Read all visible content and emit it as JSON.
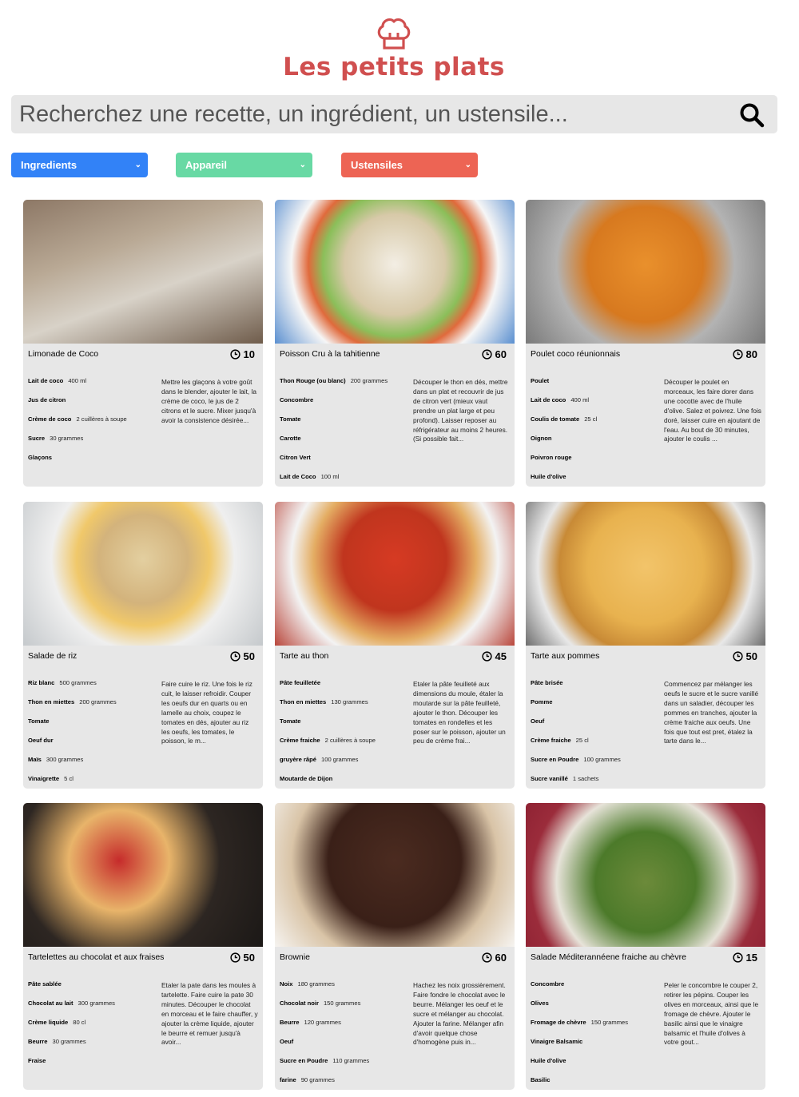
{
  "header": {
    "title": "Les petits plats",
    "logo_icon": "chef-hat-icon"
  },
  "search": {
    "placeholder": "Recherchez une recette, un ingrédient, un ustensile...",
    "icon": "search-icon"
  },
  "filters": [
    {
      "label": "Ingredients",
      "color": "#3282f7"
    },
    {
      "label": "Appareil",
      "color": "#68d9a4"
    },
    {
      "label": "Ustensiles",
      "color": "#ed6454"
    }
  ],
  "recipes": [
    {
      "title": "Limonade de Coco",
      "time": "10",
      "ingredients": [
        {
          "name": "Lait de coco",
          "qty": "400 ml"
        },
        {
          "name": "Jus de citron",
          "qty": ""
        },
        {
          "name": "Crème de coco",
          "qty": "2 cuillères à soupe"
        },
        {
          "name": "Sucre",
          "qty": "30 grammes"
        },
        {
          "name": "Glaçons",
          "qty": ""
        }
      ],
      "description": "Mettre les glaçons à votre goût dans le blender, ajouter le lait, la crème de coco, le jus de 2 citrons et le sucre. Mixer jusqu'à avoir la consistence désirée..."
    },
    {
      "title": "Poisson Cru à la tahitienne",
      "time": "60",
      "ingredients": [
        {
          "name": "Thon Rouge (ou blanc)",
          "qty": "200 grammes"
        },
        {
          "name": "Concombre",
          "qty": ""
        },
        {
          "name": "Tomate",
          "qty": ""
        },
        {
          "name": "Carotte",
          "qty": ""
        },
        {
          "name": "Citron Vert",
          "qty": ""
        },
        {
          "name": "Lait de Coco",
          "qty": "100 ml"
        }
      ],
      "description": "Découper le thon en dés, mettre dans un plat et recouvrir de jus de citron vert (mieux vaut prendre un plat large et peu profond). Laisser reposer au réfrigérateur au moins 2 heures. (Si possible fait..."
    },
    {
      "title": "Poulet coco réunionnais",
      "time": "80",
      "ingredients": [
        {
          "name": "Poulet",
          "qty": ""
        },
        {
          "name": "Lait de coco",
          "qty": "400 ml"
        },
        {
          "name": "Coulis de tomate",
          "qty": "25 cl"
        },
        {
          "name": "Oignon",
          "qty": ""
        },
        {
          "name": "Poivron rouge",
          "qty": ""
        },
        {
          "name": "Huile d'olive",
          "qty": ""
        }
      ],
      "description": "Découper le poulet en morceaux, les faire dorer dans une cocotte avec de l'huile d'olive. Salez et poivrez. Une fois doré, laisser cuire en ajoutant de l'eau. Au bout de 30 minutes, ajouter le coulis ..."
    },
    {
      "title": "Salade de riz",
      "time": "50",
      "ingredients": [
        {
          "name": "Riz blanc",
          "qty": "500 grammes"
        },
        {
          "name": "Thon en miettes",
          "qty": "200 grammes"
        },
        {
          "name": "Tomate",
          "qty": ""
        },
        {
          "name": "Oeuf dur",
          "qty": ""
        },
        {
          "name": "Maïs",
          "qty": "300 grammes"
        },
        {
          "name": "Vinaigrette",
          "qty": "5 cl"
        }
      ],
      "description": "Faire cuire le riz. Une fois le riz cuit, le laisser refroidir. Couper les oeufs dur en quarts ou en lamelle au choix, coupez le tomates en dés, ajouter au riz les oeufs, les tomates, le poisson, le m..."
    },
    {
      "title": "Tarte au thon",
      "time": "45",
      "ingredients": [
        {
          "name": "Pâte feuilletée",
          "qty": ""
        },
        {
          "name": "Thon en miettes",
          "qty": "130 grammes"
        },
        {
          "name": "Tomate",
          "qty": ""
        },
        {
          "name": "Crème fraiche",
          "qty": "2 cuillères à soupe"
        },
        {
          "name": "gruyère râpé",
          "qty": "100 grammes"
        },
        {
          "name": "Moutarde de Dijon",
          "qty": ""
        }
      ],
      "description": "Etaler la pâte feuilleté aux dimensions du moule, étaler la moutarde sur la pâte feuilleté, ajouter le thon. Découper les tomates en rondelles et les poser sur le poisson, ajouter un peu de crème frai..."
    },
    {
      "title": "Tarte aux pommes",
      "time": "50",
      "ingredients": [
        {
          "name": "Pâte brisée",
          "qty": ""
        },
        {
          "name": "Pomme",
          "qty": ""
        },
        {
          "name": "Oeuf",
          "qty": ""
        },
        {
          "name": "Crème fraiche",
          "qty": "25 cl"
        },
        {
          "name": "Sucre en Poudre",
          "qty": "100 grammes"
        },
        {
          "name": "Sucre vanillé",
          "qty": "1 sachets"
        }
      ],
      "description": "Commencez par mélanger les oeufs le sucre et le sucre vanillé dans un saladier, découper les pommes en tranches, ajouter la crème fraiche aux oeufs. Une fois que tout est pret, étalez la tarte dans le..."
    },
    {
      "title": "Tartelettes au chocolat et aux fraises",
      "time": "50",
      "ingredients": [
        {
          "name": "Pâte sablée",
          "qty": ""
        },
        {
          "name": "Chocolat au lait",
          "qty": "300 grammes"
        },
        {
          "name": "Crème liquide",
          "qty": "80 cl"
        },
        {
          "name": "Beurre",
          "qty": "30 grammes"
        },
        {
          "name": "Fraise",
          "qty": ""
        }
      ],
      "description": "Etaler la pate dans les moules à tartelette. Faire cuire la pate 30 minutes. Découper le chocolat en morceau et le faire chauffer, y ajouter la crème liquide, ajouter le beurre et remuer jusqu'à avoir..."
    },
    {
      "title": "Brownie",
      "time": "60",
      "ingredients": [
        {
          "name": "Noix",
          "qty": "180 grammes"
        },
        {
          "name": "Chocolat noir",
          "qty": "150 grammes"
        },
        {
          "name": "Beurre",
          "qty": "120 grammes"
        },
        {
          "name": "Oeuf",
          "qty": ""
        },
        {
          "name": "Sucre en Poudre",
          "qty": "110 grammes"
        },
        {
          "name": "farine",
          "qty": "90 grammes"
        }
      ],
      "description": "Hachez les noix grossièrement. Faire fondre le chocolat avec le beurre. Mélanger les oeuf et le sucre et mélanger au chocolat. Ajouter la farine. Mélanger afin d'avoir quelque chose d'homogène puis in..."
    },
    {
      "title": "Salade Méditerannéene fraiche au chèvre",
      "time": "15",
      "ingredients": [
        {
          "name": "Concombre",
          "qty": ""
        },
        {
          "name": "Olives",
          "qty": ""
        },
        {
          "name": "Fromage de chèvre",
          "qty": "150 grammes"
        },
        {
          "name": "Vinaigre Balsamic",
          "qty": ""
        },
        {
          "name": "Huile d'olive",
          "qty": ""
        },
        {
          "name": "Basilic",
          "qty": ""
        }
      ],
      "description": "Peler le concombre le couper 2, retirer les pépins. Couper les olives en morceaux, ainsi que le fromage de chèvre. Ajouter le basilic ainsi que le vinaigre balsamic et l'huile d'olives à votre gout..."
    }
  ]
}
